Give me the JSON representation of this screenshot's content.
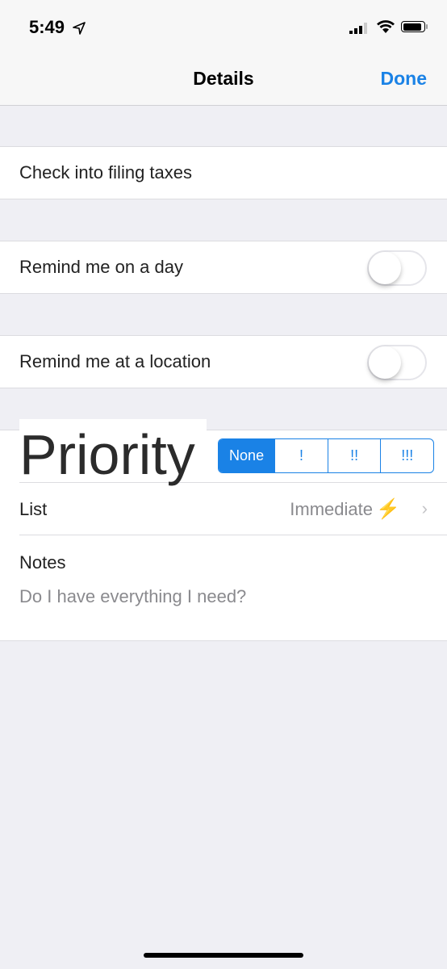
{
  "status_bar": {
    "time": "5:49",
    "location_icon": "location-arrow-icon",
    "signal_icon": "cellular-signal-icon",
    "wifi_icon": "wifi-icon",
    "battery_icon": "battery-icon"
  },
  "nav": {
    "title": "Details",
    "done_label": "Done"
  },
  "task": {
    "title": "Check into filing taxes"
  },
  "remind_day": {
    "label": "Remind me on a day",
    "enabled": false
  },
  "remind_location": {
    "label": "Remind me at a location",
    "enabled": false
  },
  "priority": {
    "label": "Priority",
    "options": [
      "None",
      "!",
      "!!",
      "!!!"
    ],
    "selected": "None"
  },
  "list": {
    "label": "List",
    "value": "Immediate",
    "emoji": "⚡",
    "chevron": "›"
  },
  "notes": {
    "label": "Notes",
    "placeholder": "Do I have everything I need?"
  },
  "colors": {
    "accent": "#1a82e6",
    "background": "#efeff4"
  }
}
